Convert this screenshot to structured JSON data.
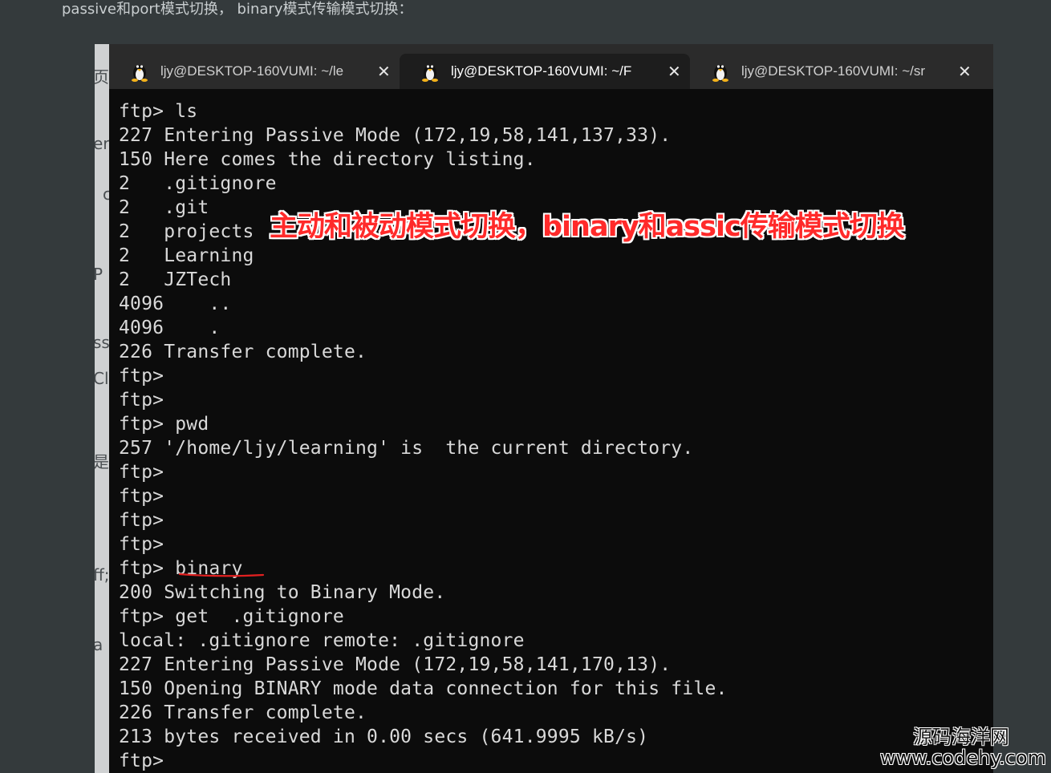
{
  "page_caption": "passive和port模式切换， binary模式传输模式切换：",
  "left_strip_fragments": [
    "页",
    "er",
    "c",
    "P",
    "ss",
    "Cl",
    "是p",
    "ff;",
    "a"
  ],
  "tabs": [
    {
      "title": "ljy@DESKTOP-160VUMI: ~/le",
      "icon": "linux-tux-icon",
      "close": "✕"
    },
    {
      "title": "ljy@DESKTOP-160VUMI: ~/F",
      "icon": "linux-tux-icon",
      "close": "✕",
      "active": true
    },
    {
      "title": "ljy@DESKTOP-160VUMI: ~/sr",
      "icon": "linux-tux-icon",
      "close": "✕"
    }
  ],
  "terminal_lines": [
    "ftp> ls",
    "227 Entering Passive Mode (172,19,58,141,137,33).",
    "150 Here comes the directory listing.",
    "2   .gitignore",
    "2   .git",
    "2   projects",
    "2   Learning",
    "2   JZTech",
    "4096    ..",
    "4096    .",
    "226 Transfer complete.",
    "ftp>",
    "ftp>",
    "ftp> pwd",
    "257 '/home/ljy/learning' is  the current directory.",
    "ftp>",
    "ftp>",
    "ftp>",
    "ftp>",
    "ftp> binary",
    "200 Switching to Binary Mode.",
    "ftp> get  .gitignore",
    "local: .gitignore remote: .gitignore",
    "227 Entering Passive Mode (172,19,58,141,170,13).",
    "150 Opening BINARY mode data connection for this file.",
    "226 Transfer complete.",
    "213 bytes received in 0.00 secs (641.9995 kB/s)",
    "ftp>"
  ],
  "annotation": {
    "text": "主动和被动模式切换，binary和assic传输模式切换",
    "color": "#ff2a2a"
  },
  "watermark": {
    "line1": "源码海洋网",
    "line2": "www.codehy.com"
  },
  "colors": {
    "page_background": "#343a3c",
    "terminal_background": "#0c0c0c",
    "terminal_text": "#d9d9d9",
    "tab_bar": "#2b2b2b",
    "underline": "#e02020"
  }
}
